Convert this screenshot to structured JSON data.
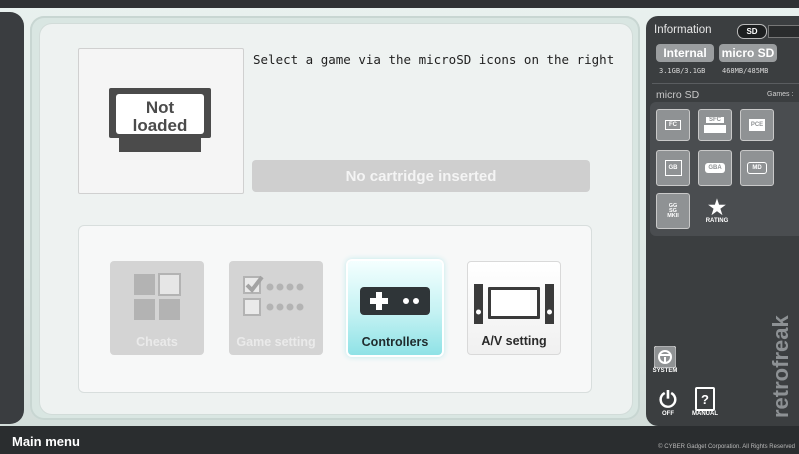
{
  "info": {
    "header": "Information",
    "sd_badge": "SD",
    "internal_label": "Internal",
    "internal_usage": "3.1GB/3.1GB",
    "microsd_label": "micro SD",
    "microsd_usage": "468MB/485MB"
  },
  "microsd": {
    "header": "micro SD",
    "games_caption": "Games :",
    "icons": [
      "FC",
      "SFC",
      "PCE",
      "GB",
      "GBA",
      "MD",
      "GG SG MKII",
      "RATING"
    ]
  },
  "system": {
    "system_label": "SYSTEM",
    "off_label": "OFF",
    "manual_label": "MANUAL"
  },
  "cartridge": {
    "image_text_line1": "Not",
    "image_text_line2": "loaded",
    "hint": "Select a game via the microSD icons on the right",
    "status": "No cartridge inserted"
  },
  "menu": {
    "cheats": "Cheats",
    "game_setting": "Game setting",
    "controllers": "Controllers",
    "av_setting": "A/V setting"
  },
  "brand": "retrofreak",
  "footer": {
    "title": "Main menu",
    "copyright": "© CYBER Gadget Corporation. All Rights Reserved"
  },
  "colors": {
    "accent_active": "#8fe2e6",
    "panel_dark": "#3b3e40",
    "disabled_bg": "#d4d4d4"
  }
}
